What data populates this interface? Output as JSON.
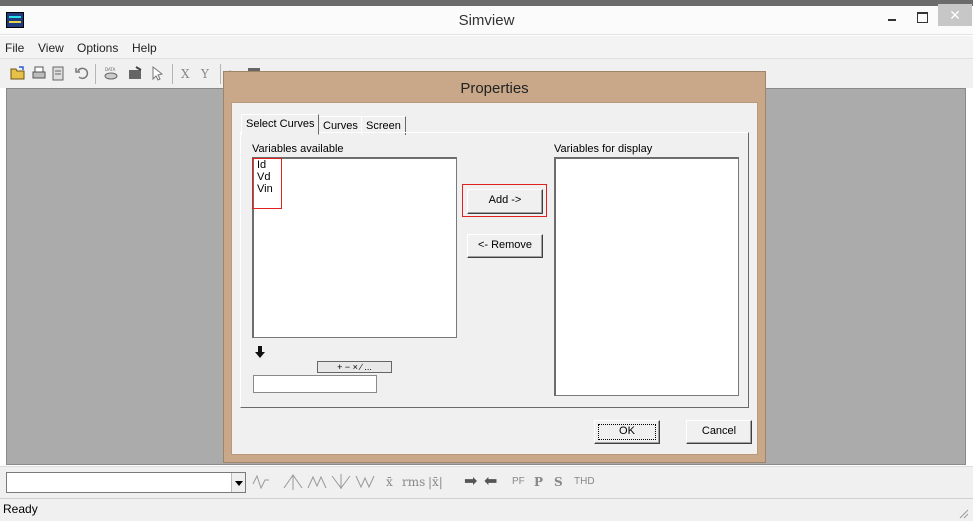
{
  "window": {
    "title": "Simview",
    "close_glyph": "✕"
  },
  "menu": {
    "items": [
      "File",
      "View",
      "Options",
      "Help"
    ]
  },
  "toolbar": {
    "icons": [
      "open-folder-icon",
      "print-icon",
      "clipboard-icon",
      "undo-icon",
      "data-icon",
      "chart-icon",
      "pointer-icon",
      "x-axis-icon",
      "y-axis-icon",
      "waveform-icon",
      "block-icon",
      "marker-icon",
      "marker-icon",
      "marker-icon",
      "zoom-icon",
      "zoom-icon",
      "zoom-icon",
      "move-left-icon",
      "move-right-icon",
      "mmm-icon",
      "target-icon",
      "plus-icon",
      "grid-icon",
      "grid-icon"
    ]
  },
  "dialog": {
    "title": "Properties",
    "tabs": [
      "Select Curves",
      "Curves",
      "Screen"
    ],
    "active_tab": "Select Curves",
    "available_label": "Variables available",
    "display_label": "Variables for display",
    "available_variables": [
      "Id",
      "Vd",
      "Vin"
    ],
    "display_variables": [],
    "add_button": "Add ->",
    "remove_button": "<- Remove",
    "operators_button": "+ − × ∕ ...",
    "expression_value": "",
    "ok_button": "OK",
    "cancel_button": "Cancel",
    "highlight_color": "#e12020"
  },
  "bottombar": {
    "combo_value": "",
    "tool_labels": {
      "x_bar": "x̄",
      "rms": "rms",
      "abs": "|x̄|",
      "pf": "PF",
      "p": "P",
      "s": "S",
      "thd": "THD"
    }
  },
  "status": {
    "text": "Ready"
  },
  "colors": {
    "workspace": "#ababab",
    "dialog_frame": "#c9a88a",
    "app_icon": "#1e3a80"
  }
}
